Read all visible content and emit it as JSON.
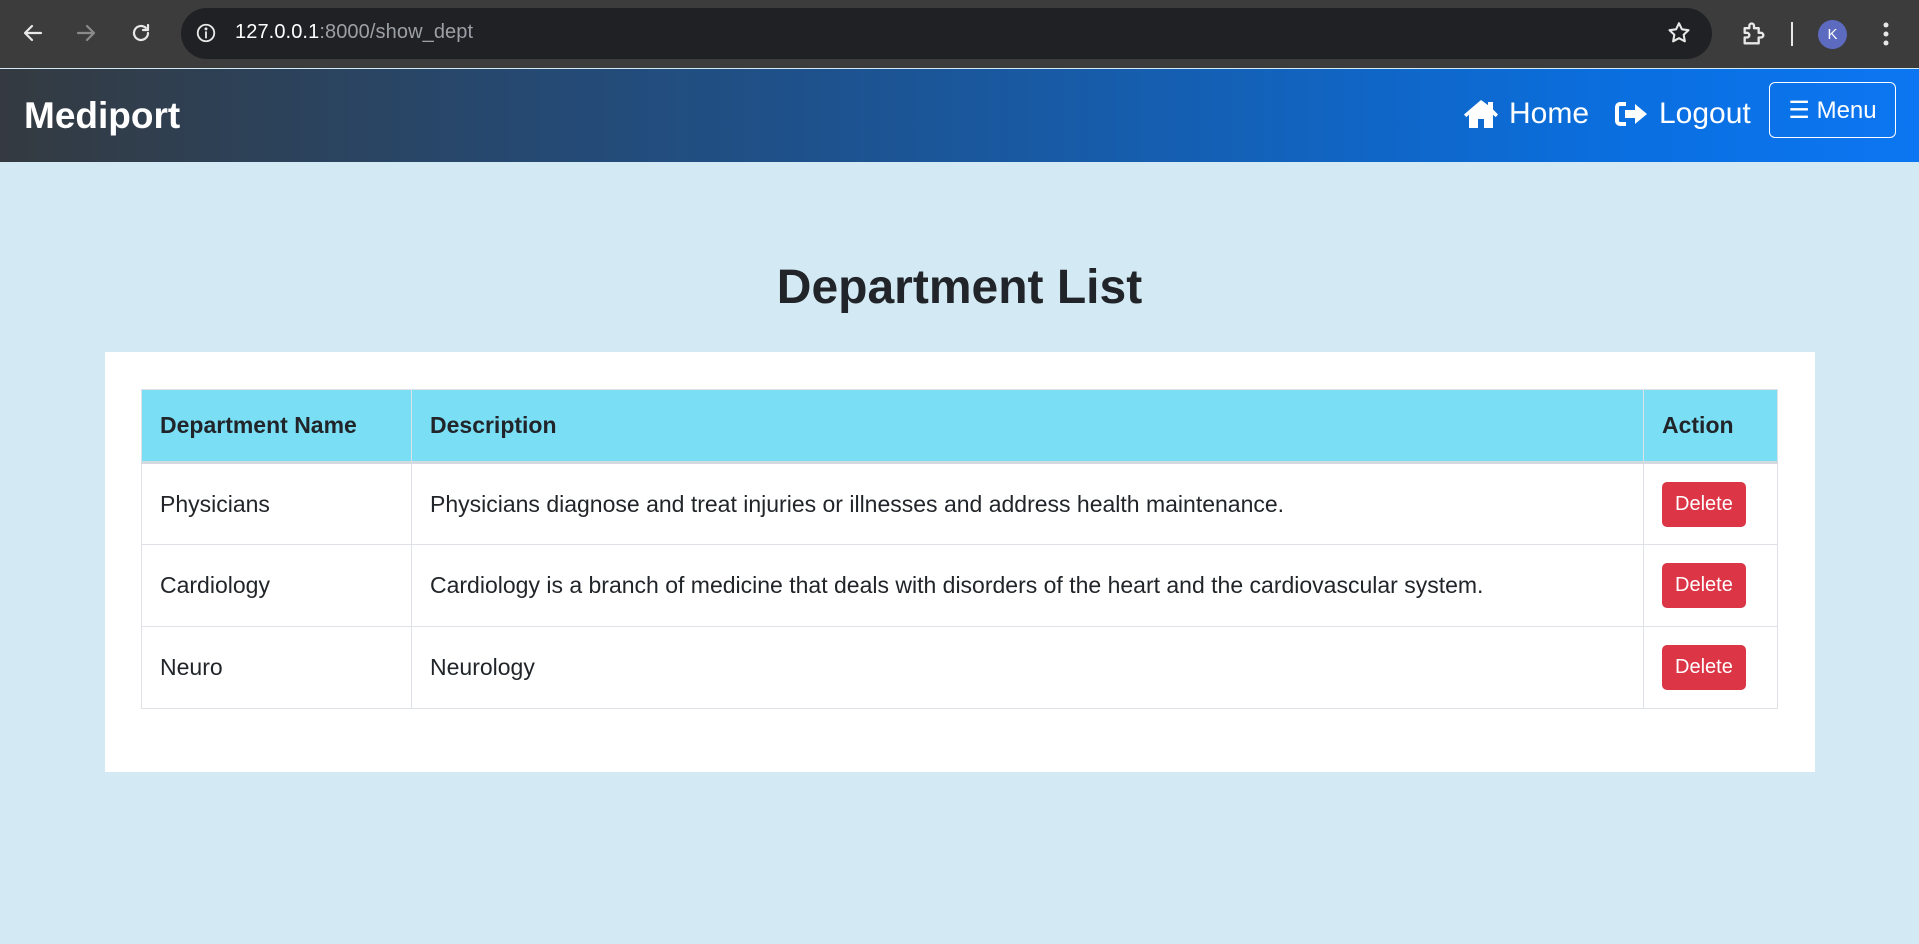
{
  "browser": {
    "url_host": "127.0.0.1",
    "url_path": ":8000/show_dept",
    "profile_initial": "K"
  },
  "navbar": {
    "brand": "Mediport",
    "home_label": "Home",
    "logout_label": "Logout",
    "menu_label": "☰ Menu"
  },
  "main": {
    "title": "Department List",
    "table": {
      "headers": [
        "Department Name",
        "Description",
        "Action"
      ],
      "rows": [
        {
          "name": "Physicians",
          "description": "Physicians diagnose and treat injuries or illnesses and address health maintenance.",
          "action": "Delete"
        },
        {
          "name": "Cardiology",
          "description": "Cardiology is a branch of medicine that deals with disorders of the heart and the cardiovascular system.",
          "action": "Delete"
        },
        {
          "name": "Neuro",
          "description": "Neurology",
          "action": "Delete"
        }
      ]
    }
  },
  "colors": {
    "page_bg": "#d3eaf4",
    "table_header_bg": "#7adff5",
    "delete_button": "#dc3545",
    "navbar_gradient_start": "#343a40",
    "navbar_gradient_end": "#0c76f2"
  }
}
